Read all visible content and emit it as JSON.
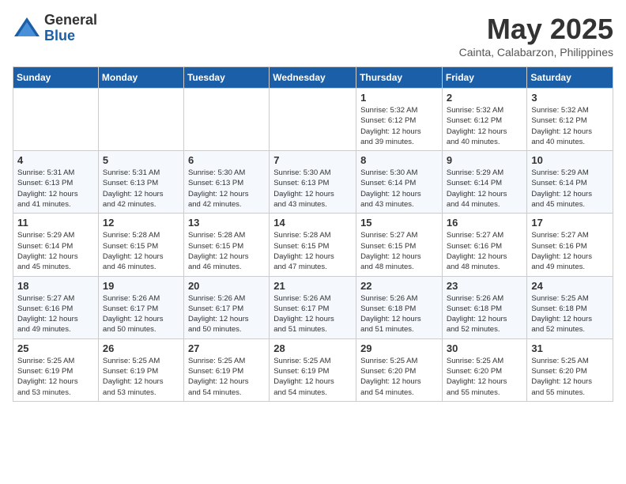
{
  "logo": {
    "general": "General",
    "blue": "Blue"
  },
  "title": {
    "month": "May 2025",
    "location": "Cainta, Calabarzon, Philippines"
  },
  "weekdays": [
    "Sunday",
    "Monday",
    "Tuesday",
    "Wednesday",
    "Thursday",
    "Friday",
    "Saturday"
  ],
  "weeks": [
    [
      {
        "day": "",
        "info": ""
      },
      {
        "day": "",
        "info": ""
      },
      {
        "day": "",
        "info": ""
      },
      {
        "day": "",
        "info": ""
      },
      {
        "day": "1",
        "info": "Sunrise: 5:32 AM\nSunset: 6:12 PM\nDaylight: 12 hours\nand 39 minutes."
      },
      {
        "day": "2",
        "info": "Sunrise: 5:32 AM\nSunset: 6:12 PM\nDaylight: 12 hours\nand 40 minutes."
      },
      {
        "day": "3",
        "info": "Sunrise: 5:32 AM\nSunset: 6:12 PM\nDaylight: 12 hours\nand 40 minutes."
      }
    ],
    [
      {
        "day": "4",
        "info": "Sunrise: 5:31 AM\nSunset: 6:13 PM\nDaylight: 12 hours\nand 41 minutes."
      },
      {
        "day": "5",
        "info": "Sunrise: 5:31 AM\nSunset: 6:13 PM\nDaylight: 12 hours\nand 42 minutes."
      },
      {
        "day": "6",
        "info": "Sunrise: 5:30 AM\nSunset: 6:13 PM\nDaylight: 12 hours\nand 42 minutes."
      },
      {
        "day": "7",
        "info": "Sunrise: 5:30 AM\nSunset: 6:13 PM\nDaylight: 12 hours\nand 43 minutes."
      },
      {
        "day": "8",
        "info": "Sunrise: 5:30 AM\nSunset: 6:14 PM\nDaylight: 12 hours\nand 43 minutes."
      },
      {
        "day": "9",
        "info": "Sunrise: 5:29 AM\nSunset: 6:14 PM\nDaylight: 12 hours\nand 44 minutes."
      },
      {
        "day": "10",
        "info": "Sunrise: 5:29 AM\nSunset: 6:14 PM\nDaylight: 12 hours\nand 45 minutes."
      }
    ],
    [
      {
        "day": "11",
        "info": "Sunrise: 5:29 AM\nSunset: 6:14 PM\nDaylight: 12 hours\nand 45 minutes."
      },
      {
        "day": "12",
        "info": "Sunrise: 5:28 AM\nSunset: 6:15 PM\nDaylight: 12 hours\nand 46 minutes."
      },
      {
        "day": "13",
        "info": "Sunrise: 5:28 AM\nSunset: 6:15 PM\nDaylight: 12 hours\nand 46 minutes."
      },
      {
        "day": "14",
        "info": "Sunrise: 5:28 AM\nSunset: 6:15 PM\nDaylight: 12 hours\nand 47 minutes."
      },
      {
        "day": "15",
        "info": "Sunrise: 5:27 AM\nSunset: 6:15 PM\nDaylight: 12 hours\nand 48 minutes."
      },
      {
        "day": "16",
        "info": "Sunrise: 5:27 AM\nSunset: 6:16 PM\nDaylight: 12 hours\nand 48 minutes."
      },
      {
        "day": "17",
        "info": "Sunrise: 5:27 AM\nSunset: 6:16 PM\nDaylight: 12 hours\nand 49 minutes."
      }
    ],
    [
      {
        "day": "18",
        "info": "Sunrise: 5:27 AM\nSunset: 6:16 PM\nDaylight: 12 hours\nand 49 minutes."
      },
      {
        "day": "19",
        "info": "Sunrise: 5:26 AM\nSunset: 6:17 PM\nDaylight: 12 hours\nand 50 minutes."
      },
      {
        "day": "20",
        "info": "Sunrise: 5:26 AM\nSunset: 6:17 PM\nDaylight: 12 hours\nand 50 minutes."
      },
      {
        "day": "21",
        "info": "Sunrise: 5:26 AM\nSunset: 6:17 PM\nDaylight: 12 hours\nand 51 minutes."
      },
      {
        "day": "22",
        "info": "Sunrise: 5:26 AM\nSunset: 6:18 PM\nDaylight: 12 hours\nand 51 minutes."
      },
      {
        "day": "23",
        "info": "Sunrise: 5:26 AM\nSunset: 6:18 PM\nDaylight: 12 hours\nand 52 minutes."
      },
      {
        "day": "24",
        "info": "Sunrise: 5:25 AM\nSunset: 6:18 PM\nDaylight: 12 hours\nand 52 minutes."
      }
    ],
    [
      {
        "day": "25",
        "info": "Sunrise: 5:25 AM\nSunset: 6:19 PM\nDaylight: 12 hours\nand 53 minutes."
      },
      {
        "day": "26",
        "info": "Sunrise: 5:25 AM\nSunset: 6:19 PM\nDaylight: 12 hours\nand 53 minutes."
      },
      {
        "day": "27",
        "info": "Sunrise: 5:25 AM\nSunset: 6:19 PM\nDaylight: 12 hours\nand 54 minutes."
      },
      {
        "day": "28",
        "info": "Sunrise: 5:25 AM\nSunset: 6:19 PM\nDaylight: 12 hours\nand 54 minutes."
      },
      {
        "day": "29",
        "info": "Sunrise: 5:25 AM\nSunset: 6:20 PM\nDaylight: 12 hours\nand 54 minutes."
      },
      {
        "day": "30",
        "info": "Sunrise: 5:25 AM\nSunset: 6:20 PM\nDaylight: 12 hours\nand 55 minutes."
      },
      {
        "day": "31",
        "info": "Sunrise: 5:25 AM\nSunset: 6:20 PM\nDaylight: 12 hours\nand 55 minutes."
      }
    ]
  ]
}
